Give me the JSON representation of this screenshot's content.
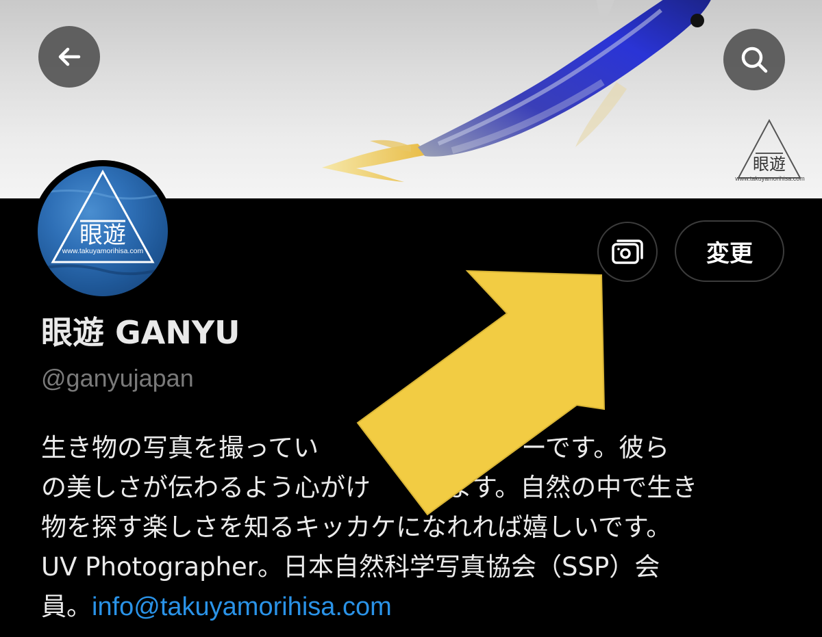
{
  "colors": {
    "background": "#000000",
    "link": "#2a93e8",
    "arrow": "#f2cc43",
    "handle": "#7a7a7a",
    "avatar_water": "#2e6fb6"
  },
  "header": {
    "back_icon": "arrow-left-icon",
    "search_icon": "search-icon",
    "banner_logo_url": "www.takuyamorihisa.com"
  },
  "avatar": {
    "logo_url": "www.takuyamorihisa.com"
  },
  "actions": {
    "photo_icon": "photo-gallery-icon",
    "edit_label": "変更"
  },
  "profile": {
    "display_name": "眼遊 GANYU",
    "handle": "@ganyujapan",
    "bio_lines": [
      "生き物の写真を撮ってい　　　　　ラファーです。彼ら",
      "の美しさが伝わるよう心がけ　　います。自然の中で生き",
      "物を探す楽しさを知るキッカケになれれば嬉しいです。",
      "UV Photographer。日本自然科学写真協会（SSP）会",
      "員。"
    ],
    "email": "info@takuyamorihisa.com"
  },
  "overlay": {
    "annotation_icon": "yellow-arrow-pointer"
  }
}
